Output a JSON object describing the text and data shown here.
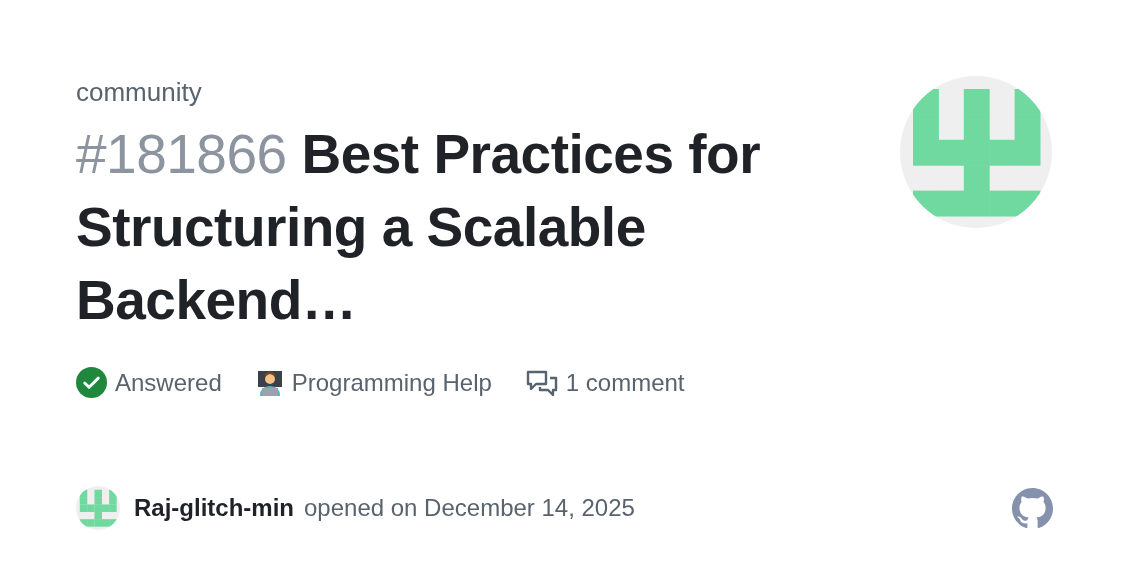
{
  "repository": "community",
  "issue": {
    "number": "#181866",
    "title": "Best Practices for Structuring a Scalable Backend…"
  },
  "meta": [
    {
      "kind": "status",
      "label": "Answered"
    },
    {
      "kind": "category",
      "label": "Programming Help"
    },
    {
      "kind": "comments",
      "label": "1 comment"
    }
  ],
  "author": {
    "name": "Raj-glitch-min",
    "opened": "opened on December 14, 2025"
  }
}
